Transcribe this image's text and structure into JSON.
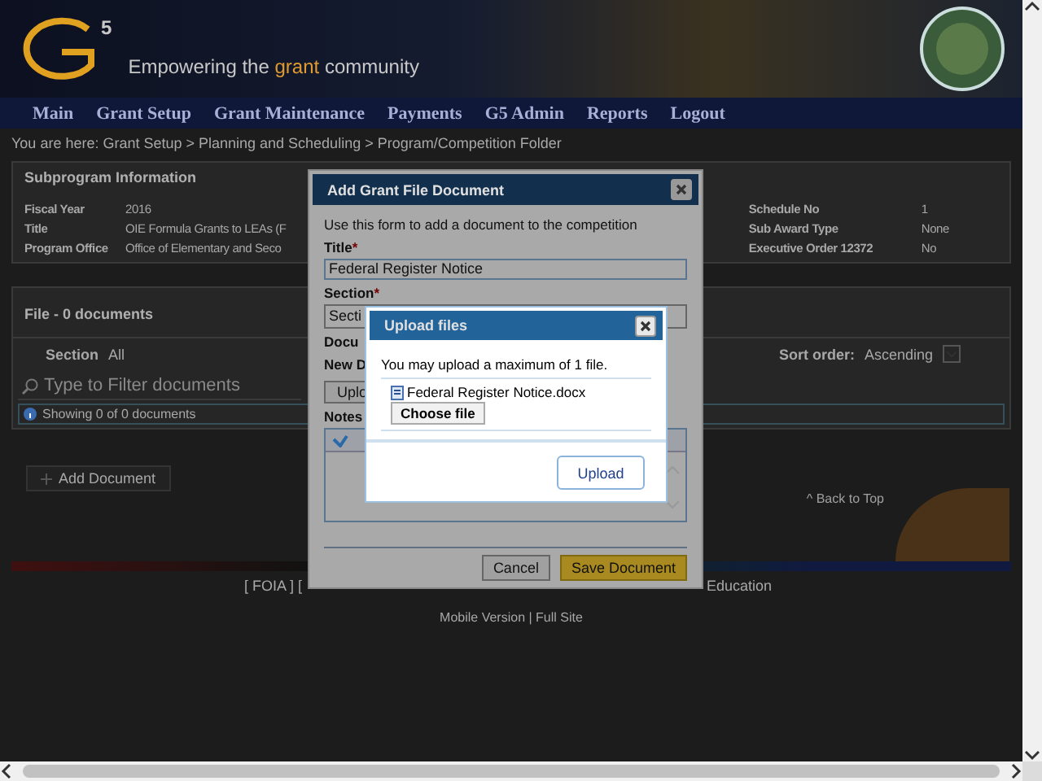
{
  "header": {
    "logo_superscript": "5",
    "tagline": {
      "before": "Empowering the",
      "highlight": "grant",
      "after": "community"
    }
  },
  "nav": [
    {
      "label": "Main"
    },
    {
      "label": "Grant Setup"
    },
    {
      "label": "Grant Maintenance"
    },
    {
      "label": "Payments"
    },
    {
      "label": "G5 Admin"
    },
    {
      "label": "Reports"
    },
    {
      "label": "Logout"
    }
  ],
  "breadcrumb": "You are here: Grant Setup > Planning and Scheduling > Program/Competition Folder",
  "subprogram": {
    "heading": "Subprogram Information",
    "left": [
      {
        "label": "Fiscal Year",
        "value": "2016"
      },
      {
        "label": "Title",
        "value": "OIE Formula Grants to LEAs (F"
      },
      {
        "label": "Program Office",
        "value": "Office of Elementary and Seco"
      }
    ],
    "right": [
      {
        "label": "Schedule No",
        "value": "1"
      },
      {
        "label": "Sub Award Type",
        "value": "None"
      },
      {
        "label": "Executive Order 12372",
        "value": "No"
      }
    ]
  },
  "files": {
    "heading": "File - 0 documents",
    "section_label": "Section",
    "section_value": "All",
    "sort_label": "Sort order:",
    "sort_value": "Ascending",
    "filter_placeholder": "Type to Filter documents",
    "showing": "Showing 0 of 0 documents",
    "add_button": "Add Document",
    "back_to_top": "^ Back to Top"
  },
  "footer": {
    "links_left": "[ FOIA ] [",
    "links_right": "Education",
    "versions": "Mobile Version | Full Site"
  },
  "add_dialog": {
    "title": "Add Grant File Document",
    "intro": "Use this form to add a document to the competition",
    "fields": [
      {
        "kind": "text",
        "label": "Title",
        "required_mark": "*",
        "value": "Federal Register Notice"
      },
      {
        "kind": "select",
        "label": "Section",
        "required_mark": "*",
        "value": "Secti"
      },
      {
        "kind": "label",
        "label": "Docu"
      },
      {
        "kind": "label",
        "label": "New D"
      },
      {
        "kind": "button",
        "label": "Uplo"
      },
      {
        "kind": "editor",
        "label": "Notes"
      }
    ],
    "buttons": [
      {
        "label": "Cancel",
        "primary": false
      },
      {
        "label": "Save Document",
        "primary": true
      }
    ]
  },
  "upload_dialog": {
    "title": "Upload files",
    "message": "You may upload a maximum of 1 file.",
    "file_name": "Federal Register Notice.docx",
    "choose_button": "Choose file",
    "upload_button": "Upload"
  }
}
